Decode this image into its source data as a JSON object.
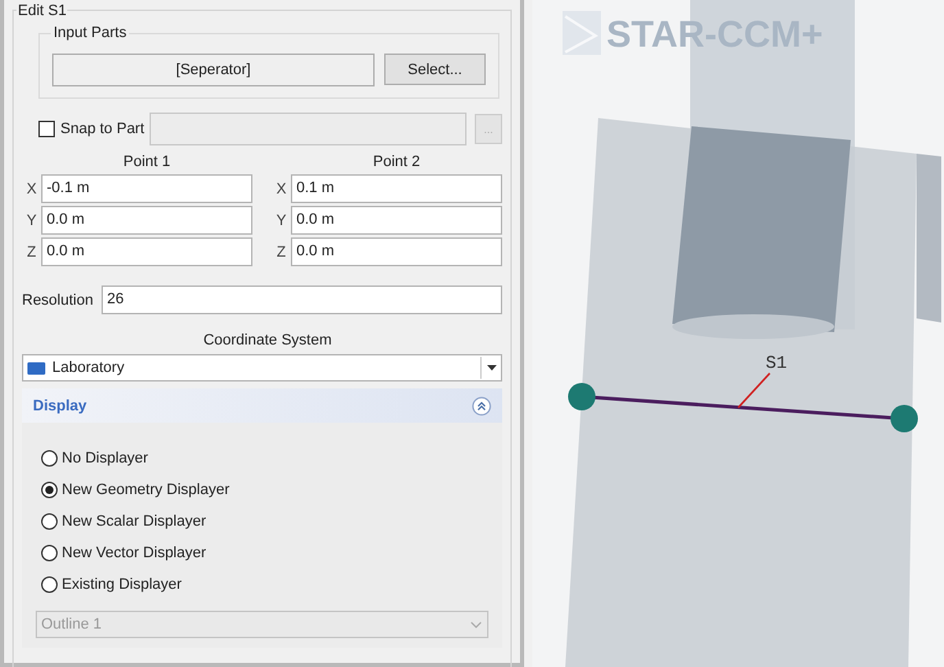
{
  "panel": {
    "title": "Edit S1",
    "input_parts": {
      "title": "Input Parts",
      "value": "[Seperator]",
      "button": "Select..."
    },
    "snap": {
      "label": "Snap to Part",
      "checked": false,
      "button": "..."
    },
    "points": [
      {
        "heading": "Point 1",
        "coords": [
          {
            "axis": "X",
            "value": "-0.1 m"
          },
          {
            "axis": "Y",
            "value": "0.0 m"
          },
          {
            "axis": "Z",
            "value": "0.0 m"
          }
        ]
      },
      {
        "heading": "Point 2",
        "coords": [
          {
            "axis": "X",
            "value": "0.1 m"
          },
          {
            "axis": "Y",
            "value": "0.0 m"
          },
          {
            "axis": "Z",
            "value": "0.0 m"
          }
        ]
      }
    ],
    "resolution": {
      "label": "Resolution",
      "value": "26"
    },
    "coordinate_system": {
      "label": "Coordinate System",
      "value": "Laboratory"
    },
    "display": {
      "title": "Display",
      "expanded": true,
      "options": [
        {
          "label": "No Displayer",
          "selected": false
        },
        {
          "label": "New Geometry Displayer",
          "selected": true
        },
        {
          "label": "New Scalar Displayer",
          "selected": false
        },
        {
          "label": "New Vector Displayer",
          "selected": false
        },
        {
          "label": "Existing Displayer",
          "selected": false
        }
      ],
      "existing": {
        "value": "Outline 1",
        "disabled": true
      }
    }
  },
  "viewport": {
    "logo": "STAR-CCM+",
    "probe_label": "S1"
  }
}
